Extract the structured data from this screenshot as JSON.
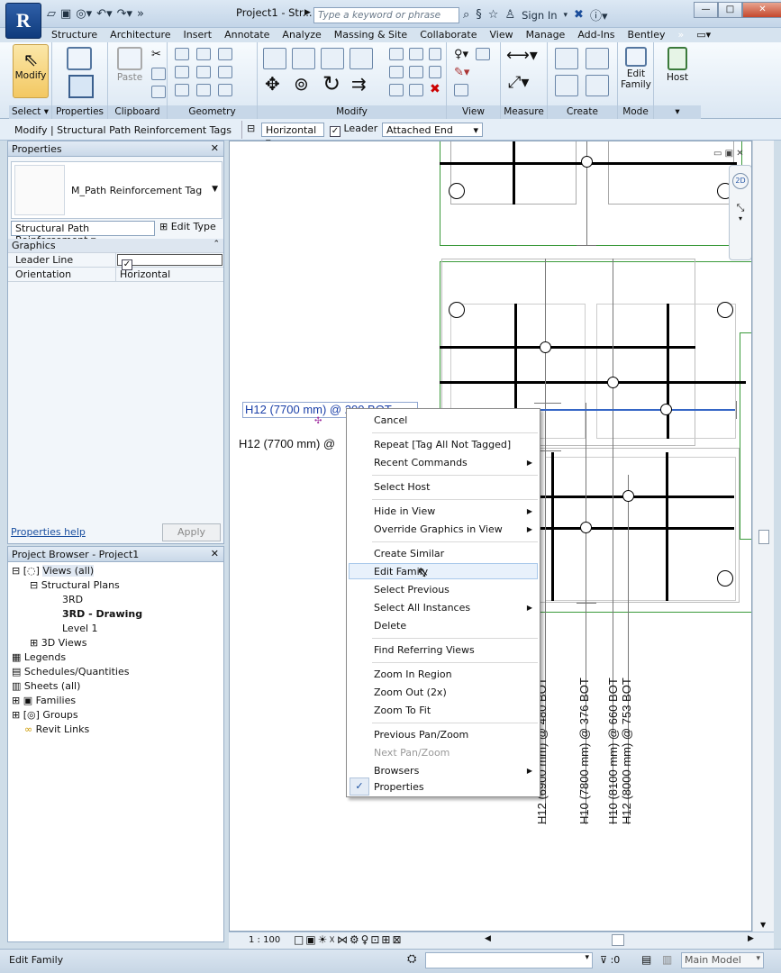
{
  "app": {
    "logo": "R",
    "title": "Project1 - Str...",
    "search_placeholder": "Type a keyword or phrase",
    "sign_in": "Sign In"
  },
  "tabs": [
    "Structure",
    "Architecture",
    "Insert",
    "Annotate",
    "Analyze",
    "Massing & Site",
    "Collaborate",
    "View",
    "Manage",
    "Add-Ins",
    "Bentley"
  ],
  "ribbon": {
    "modify_label": "Modify",
    "paste_label": "Paste",
    "edit_family_label": "Edit Family",
    "host_label": "Host",
    "panels": {
      "select": "Select ▾",
      "properties": "Properties",
      "clipboard": "Clipboard",
      "geometry": "Geometry",
      "modify": "Modify",
      "view": "View",
      "measure": "Measure",
      "create": "Create",
      "mode": "Mode"
    }
  },
  "optbar": {
    "context": "Modify | Structural Path Reinforcement Tags",
    "orientation": "Horizontal",
    "leader_label": "Leader",
    "attach": "Attached End"
  },
  "properties": {
    "title": "Properties",
    "type_name": "M_Path Reinforcement Tag",
    "category": "Structural Path Reinforcement",
    "edit_type": "Edit Type",
    "group": "Graphics",
    "rows": [
      {
        "name": "Leader Line",
        "value": "✓"
      },
      {
        "name": "Orientation",
        "value": "Horizontal"
      }
    ],
    "help": "Properties help",
    "apply": "Apply"
  },
  "browser": {
    "title": "Project Browser - Project1",
    "items": [
      "Views (all)",
      "Structural Plans",
      "3RD",
      "3RD - Drawing",
      "Level 1",
      "3D Views",
      "Legends",
      "Schedules/Quantities",
      "Sheets (all)",
      "Families",
      "Groups",
      "Revit Links"
    ]
  },
  "canvas": {
    "tag_selected": "H12 (7700 mm) @ 200 BOT",
    "tag_other": "H12 (7700 mm) @",
    "vertical_tags": [
      "H12 (6900 mm) @ 480 BOT",
      "H10 (7800 mm) @ 376 BOT",
      "H10 (8100 mm) @ 660 BOT",
      "H12 (8000 mm) @ 753 BOT"
    ]
  },
  "menu": {
    "items": [
      "Cancel",
      "Repeat [Tag All Not Tagged]",
      "Recent Commands",
      "Select Host",
      "Hide in View",
      "Override Graphics in View",
      "Create Similar",
      "Edit Family",
      "Select Previous",
      "Select All Instances",
      "Delete",
      "Find Referring Views",
      "Zoom In Region",
      "Zoom Out (2x)",
      "Zoom To Fit",
      "Previous Pan/Zoom",
      "Next Pan/Zoom",
      "Browsers",
      "Properties"
    ]
  },
  "viewbar": {
    "scale": "1 : 100"
  },
  "status": {
    "text": "Edit Family",
    "filter_count": ":0",
    "model": "Main Model"
  }
}
